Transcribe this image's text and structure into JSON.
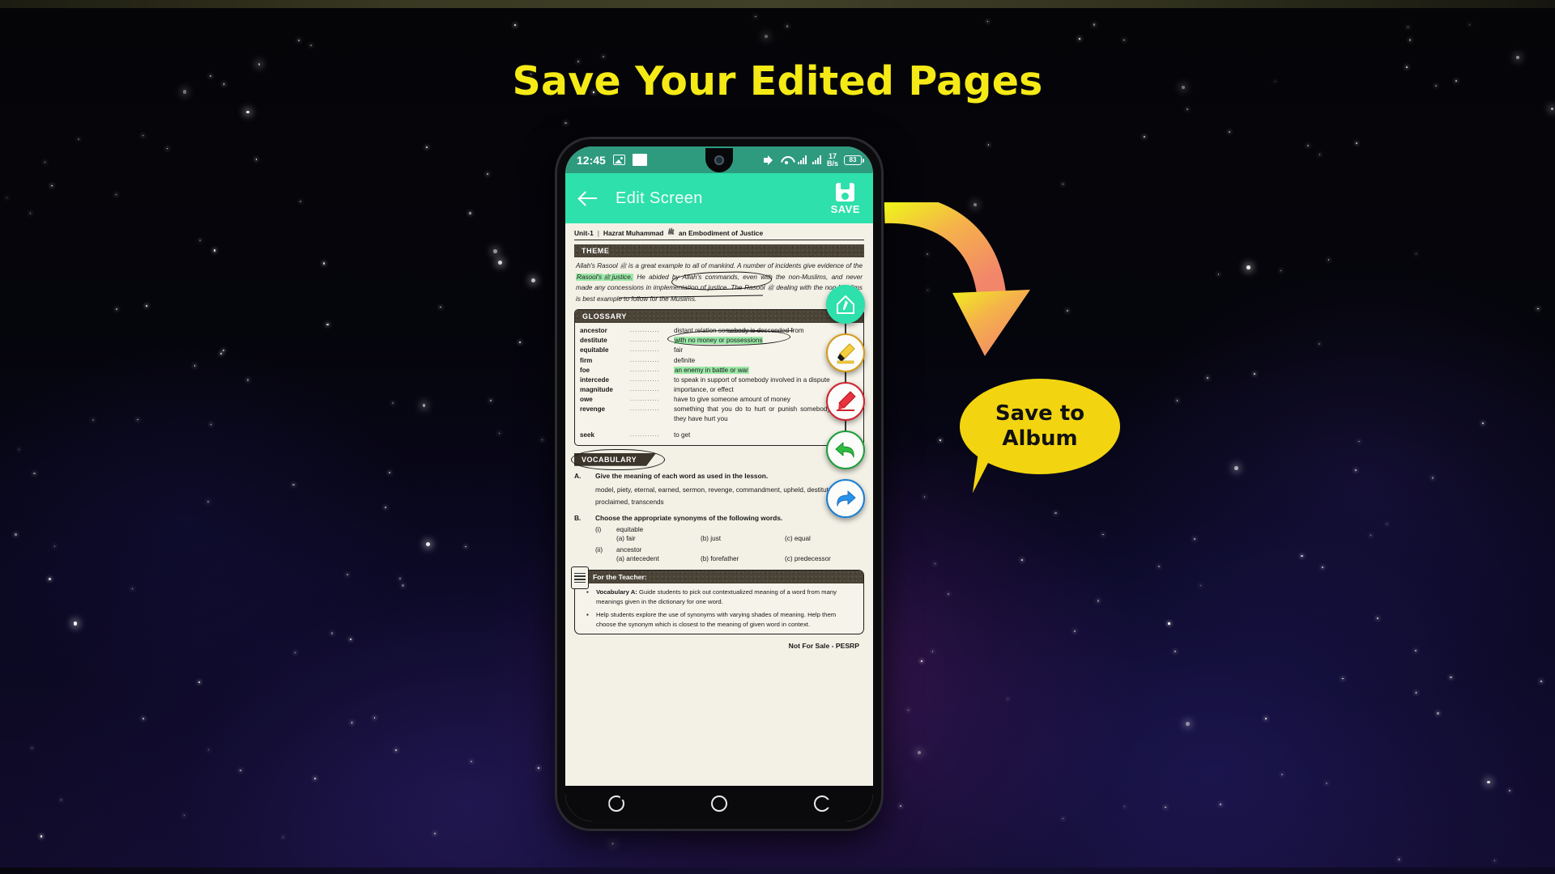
{
  "headline": "Save Your Edited Pages",
  "theme": {
    "accent_teal": "#2ee0ab",
    "headline_yellow": "#f5ea16",
    "callout_yellow": "#f2d510"
  },
  "callout": {
    "line1": "Save to",
    "line2": "Album"
  },
  "phone": {
    "status_bar": {
      "time": "12:45",
      "image_icon": "image-icon",
      "screenshot_icon": "white-box-icon",
      "volume_icon": "volume-icon",
      "wifi_icon": "wifi-icon",
      "signal_icon_1": "signal-bars-icon",
      "signal_icon_2": "signal-bars-icon",
      "data_speed_value": "17",
      "data_speed_unit": "B/s",
      "battery_level": "83"
    },
    "app_bar": {
      "back_icon": "back-arrow-icon",
      "title": "Edit Screen",
      "save_icon": "floppy-disk-icon",
      "save_label": "SAVE"
    },
    "tools": [
      {
        "name": "edit-tool",
        "label": "Edit"
      },
      {
        "name": "highlighter-tool",
        "label": "Highlighter"
      },
      {
        "name": "pen-tool",
        "label": "Pen"
      },
      {
        "name": "undo-tool",
        "label": "Undo"
      },
      {
        "name": "redo-tool",
        "label": "Redo"
      }
    ],
    "nav_bar": {
      "recents": "recents-icon",
      "home": "home-icon",
      "back": "back-icon"
    }
  },
  "document": {
    "unit_label": "Unit-1",
    "unit_title_a": "Hazrat Muhammad",
    "unit_title_squiggle": "صلى الله عليه وسلم",
    "unit_title_b": "an Embodiment of Justice",
    "theme_heading": "THEME",
    "theme_paragraph_1": "Allah's Rasool",
    "theme_paragraph_2": "is a great example to all of mankind. A number of incidents give evidence of the",
    "theme_highlight_1": "Rasool's",
    "theme_highlight_2": "justice.",
    "theme_paragraph_3": "He abided by Allah's commands, even with the non-Muslims, and never made any concessions in implementation of justice. The Rasool",
    "theme_paragraph_4": "dealing with the non-Muslims is best example to follow for the Muslims.",
    "glossary_heading": "GLOSSARY",
    "glossary": [
      {
        "word": "ancestor",
        "dots": "............",
        "definition": "distant relation somebody is descended from",
        "highlight": false
      },
      {
        "word": "destitute",
        "dots": "............",
        "definition": "with no money or possessions",
        "highlight": true
      },
      {
        "word": "equitable",
        "dots": "............",
        "definition": "fair",
        "highlight": false
      },
      {
        "word": "firm",
        "dots": "............",
        "definition": "definite",
        "highlight": false
      },
      {
        "word": "foe",
        "dots": "............",
        "definition": "an enemy in battle or war",
        "highlight": true
      },
      {
        "word": "intercede",
        "dots": "............",
        "definition": "to speak in support of somebody involved in a dispute",
        "highlight": false
      },
      {
        "word": "magnitude",
        "dots": "............",
        "definition": "importance, or effect",
        "highlight": false
      },
      {
        "word": "owe",
        "dots": "............",
        "definition": "have to give someone amount of money",
        "highlight": false
      },
      {
        "word": "revenge",
        "dots": "............",
        "definition": "something that you do to hurt or punish somebody because they have hurt you",
        "highlight": false
      },
      {
        "word": "seek",
        "dots": "............",
        "definition": "to get",
        "highlight": false
      }
    ],
    "vocabulary_heading": "VOCABULARY",
    "question_a_letter": "A.",
    "question_a_head": "Give the meaning of each word as used in the lesson.",
    "question_a_words": "model,  piety,  eternal,  earned,  sermon,  revenge,  commandment, upheld, destitute, proclaimed, transcends",
    "question_b_letter": "B.",
    "question_b_head": "Choose the appropriate synonyms of the following words.",
    "sub_items": [
      {
        "number": "(i)",
        "word": "equitable",
        "options": [
          "(a) fair",
          "(b) just",
          "(c) equal"
        ]
      },
      {
        "number": "(ii)",
        "word": "ancestor",
        "options": [
          "(a) antecedent",
          "(b) forefather",
          "(c) predecessor"
        ]
      }
    ],
    "teacher_heading": "For the Teacher:",
    "teacher_notes": [
      {
        "bold": "Vocabulary A:",
        "text": " Guide students to pick out contextualized meaning of a word from many meanings given in the dictionary for one word."
      },
      {
        "bold": "",
        "text": "Help students explore the use of synonyms with varying shades of meaning. Help them choose the synonym which is closest to the meaning of given word in context."
      }
    ],
    "footer": "Not For Sale - PESRP"
  }
}
